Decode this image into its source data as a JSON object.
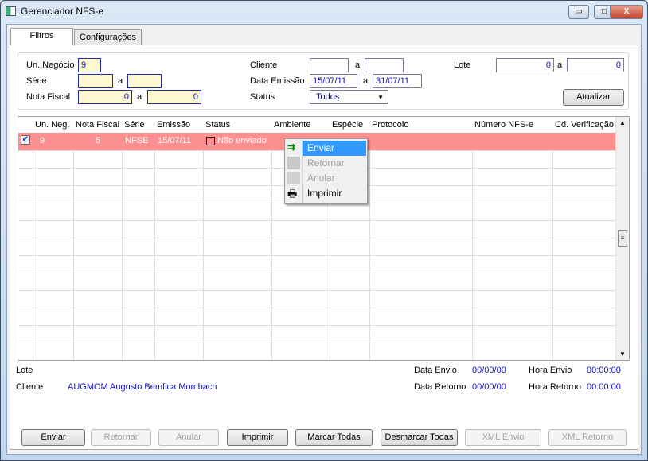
{
  "window": {
    "title": "Gerenciador NFS-e",
    "minimize": "▭",
    "maximize": "□",
    "close": "X"
  },
  "tabs": [
    {
      "label": "Filtros",
      "active": true
    },
    {
      "label": "Configurações",
      "active": false
    }
  ],
  "filters": {
    "un_negocio": {
      "label": "Un. Negócio",
      "value": "9"
    },
    "serie": {
      "label": "Série",
      "from": "",
      "sep": "a",
      "to": ""
    },
    "nota_fiscal": {
      "label": "Nota Fiscal",
      "from": "0",
      "sep": "a",
      "to": "0"
    },
    "cliente": {
      "label": "Cliente",
      "from": "",
      "sep": "a",
      "to": ""
    },
    "data_emissao": {
      "label": "Data Emissão",
      "from": "15/07/11",
      "sep": "a",
      "to": "31/07/11"
    },
    "status": {
      "label": "Status",
      "value": "Todos"
    },
    "lote": {
      "label": "Lote",
      "from": "0",
      "sep": "a",
      "to": "0"
    },
    "atualizar": "Atualizar"
  },
  "grid": {
    "columns": [
      "Un. Neg.",
      "Nota Fiscal",
      "Série",
      "Emissão",
      "Status",
      "Ambiente",
      "Espécie",
      "Protocolo",
      "Número NFS-e",
      "Cd. Verificação"
    ],
    "rows": [
      {
        "checked": true,
        "un_neg": "9",
        "nota_fiscal": "5",
        "serie": "NFSE",
        "emissao": "15/07/11",
        "status": "Não enviado",
        "ambiente": "",
        "especie": "",
        "protocolo": "",
        "numero": "",
        "cd_verificacao": ""
      }
    ]
  },
  "context_menu": [
    {
      "label": "Enviar",
      "enabled": true,
      "highlighted": true
    },
    {
      "label": "Retornar",
      "enabled": false
    },
    {
      "label": "Anular",
      "enabled": false
    },
    {
      "label": "Imprimir",
      "enabled": true
    }
  ],
  "details": {
    "lote_label": "Lote",
    "cliente_label": "Cliente",
    "cliente_code": "AUGMOM",
    "cliente_name": "Augusto Bemfica Mombach",
    "data_envio_label": "Data Envio",
    "data_envio": "00/00/00",
    "hora_envio_label": "Hora Envio",
    "hora_envio": "00:00:00",
    "data_retorno_label": "Data Retorno",
    "data_retorno": "00/00/00",
    "hora_retorno_label": "Hora Retorno",
    "hora_retorno": "00:00:00"
  },
  "buttons": [
    {
      "label": "Enviar",
      "enabled": true
    },
    {
      "label": "Retornar",
      "enabled": false
    },
    {
      "label": "Anular",
      "enabled": false
    },
    {
      "label": "Imprimir",
      "enabled": true
    },
    {
      "label": "Marcar Todas",
      "enabled": true
    },
    {
      "label": "Desmarcar Todas",
      "enabled": true
    },
    {
      "label": "XML Envio",
      "enabled": false
    },
    {
      "label": "XML Retorno",
      "enabled": false
    }
  ]
}
